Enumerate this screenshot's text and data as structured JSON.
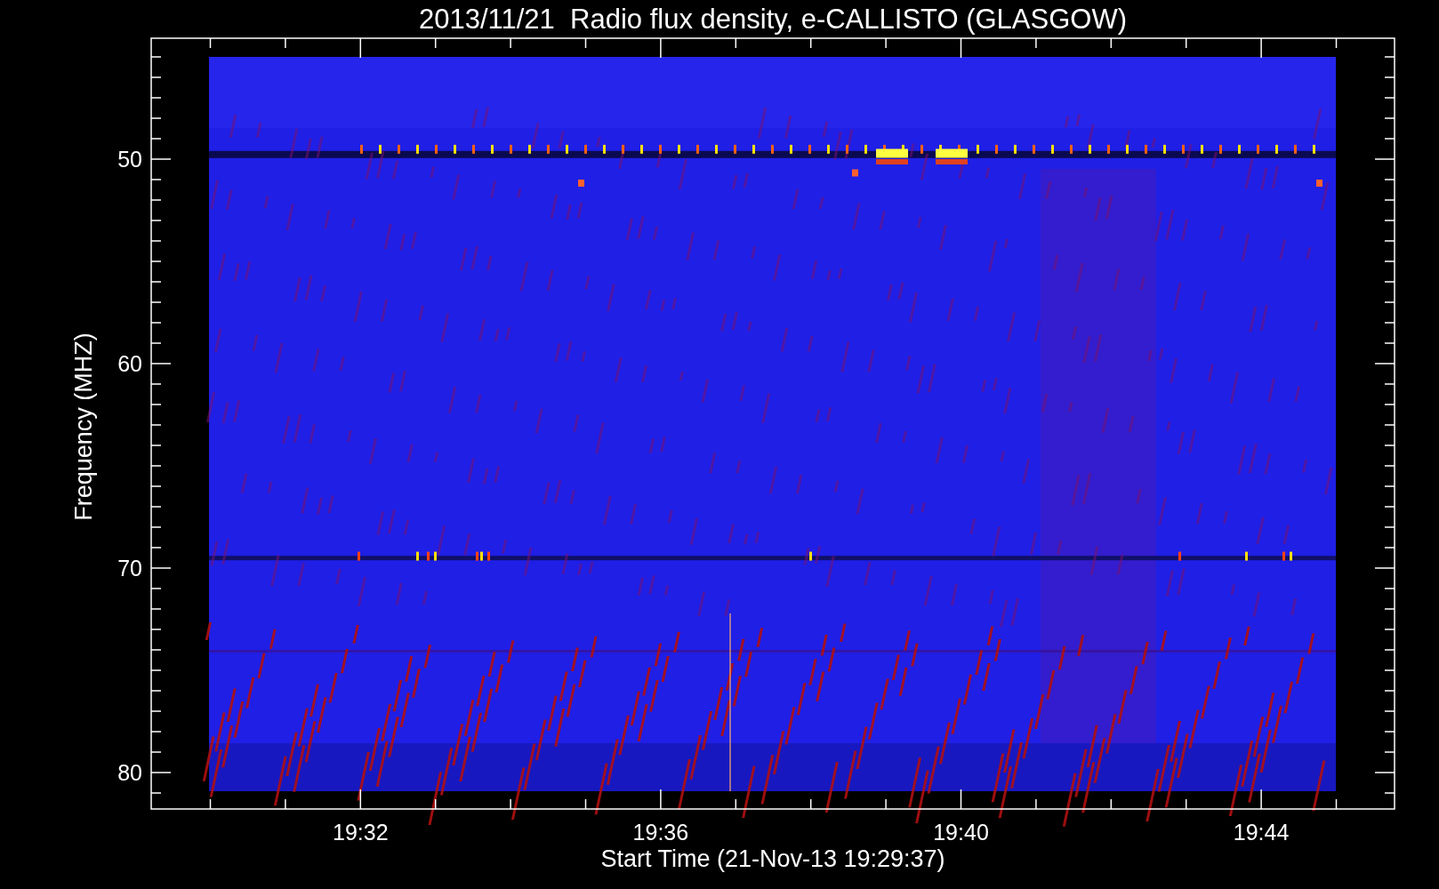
{
  "title": "2013/11/21  Radio flux density, e-CALLISTO (GLASGOW)",
  "ylabel": "Frequency (MHZ)",
  "xlabel": "Start Time (21-Nov-13 19:29:37)",
  "yticks": [
    "50",
    "60",
    "70",
    "80"
  ],
  "xticks": [
    "19:32",
    "19:36",
    "19:40",
    "19:44"
  ]
}
